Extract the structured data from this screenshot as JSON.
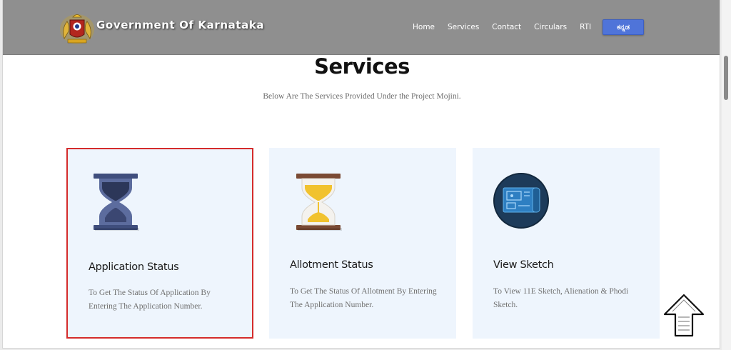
{
  "header": {
    "brand": "Government Of Karnataka",
    "emblem_icon": "karnataka-emblem-icon",
    "nav": [
      {
        "label": "Home"
      },
      {
        "label": "Services"
      },
      {
        "label": "Contact"
      },
      {
        "label": "Circulars"
      },
      {
        "label": "RTI"
      }
    ],
    "language_button": "ಕನ್ನಡ",
    "colors": {
      "bar": "#8f8f8f",
      "language_button": "#4f74d9"
    }
  },
  "main": {
    "title": "Services",
    "subtitle": "Below Are The Services Provided Under the Project Mojini.",
    "cards": [
      {
        "title": "Application Status",
        "description": "To Get The Status Of Application By Entering The Application Number.",
        "icon": "hourglass-blue-icon",
        "selected": true
      },
      {
        "title": "Allotment Status",
        "description": "To Get The Status Of Allotment By Entering The Application Number.",
        "icon": "hourglass-gold-icon",
        "selected": false
      },
      {
        "title": "View Sketch",
        "description": "To View 11E Sketch, Alienation & Phodi Sketch.",
        "icon": "blueprint-icon",
        "selected": false
      }
    ],
    "colors": {
      "card_bg": "#eef5fd",
      "highlight_border": "#d42c2c"
    }
  },
  "scroll_top_icon": "scroll-up-arrow-icon"
}
